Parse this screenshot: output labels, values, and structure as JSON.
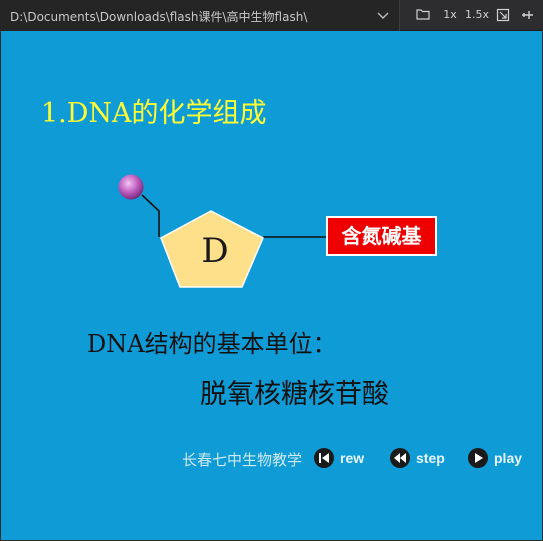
{
  "toolbar": {
    "path": "D:\\Documents\\Downloads\\flash课件\\高中生物flash\\",
    "zoom_1x": "1x",
    "zoom_15x": "1.5x",
    "icons": [
      "chevron-down-icon",
      "folder-icon",
      "fit-window-icon",
      "pin-icon"
    ]
  },
  "slide": {
    "title": "1.DNA的化学组成",
    "sugar_letter": "D",
    "base_label": "含氮碱基",
    "unit_label": "DNA结构的基本单位：",
    "unit_value": "脱氧核糖核苷酸",
    "credit": "长春七中生物教学",
    "controls": {
      "rew": "rew",
      "step": "step",
      "play": "play"
    }
  },
  "colors": {
    "stage_bg": "#0e9bd6",
    "title": "#ffff33",
    "sugar_fill": "#ffe08a",
    "phosphate": "#c060c0",
    "base_box": "#ee0000"
  }
}
